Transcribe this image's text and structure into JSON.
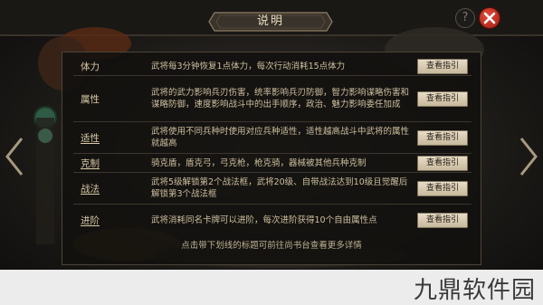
{
  "dialog": {
    "title": "说明"
  },
  "rows": [
    {
      "label": "体力",
      "underline": false,
      "desc": "武将每3分钟恢复1点体力，每次行动消耗15点体力",
      "button": "查看指引"
    },
    {
      "label": "属性",
      "underline": false,
      "desc": "武将的武力影响兵刃伤害，统率影响兵刃防御，智力影响谋略伤害和谋略防御，速度影响战斗中的出手顺序，政治、魅力影响委任加成",
      "button": "查看指引"
    },
    {
      "label": "适性",
      "underline": true,
      "desc": "武将使用不同兵种时使用对应兵种适性，适性越高战斗中武将的属性就越高",
      "button": "查看指引"
    },
    {
      "label": "克制",
      "underline": true,
      "desc": "骑克盾，盾克弓，弓克枪，枪克骑，器械被其他兵种克制",
      "button": "查看指引"
    },
    {
      "label": "战法",
      "underline": true,
      "desc": "武将5级解锁第2个战法框，武将20级、自带战法达到10级且觉醒后解锁第3个战法框",
      "button": "查看指引"
    },
    {
      "label": "进阶",
      "underline": true,
      "desc": "武将消耗同名卡牌可以进阶，每次进阶获得10个自由属性点",
      "button": "查看指引"
    }
  ],
  "footer": {
    "hint": "点击带下划线的标题可前往尚书台查看更多详情"
  },
  "watermark": {
    "text": "九鼎软件园"
  },
  "icons": {
    "help": "?",
    "close": "close-icon"
  },
  "colors": {
    "accent": "#d8c9a6",
    "close": "#c42a1e",
    "button": "#d9ccb1"
  }
}
